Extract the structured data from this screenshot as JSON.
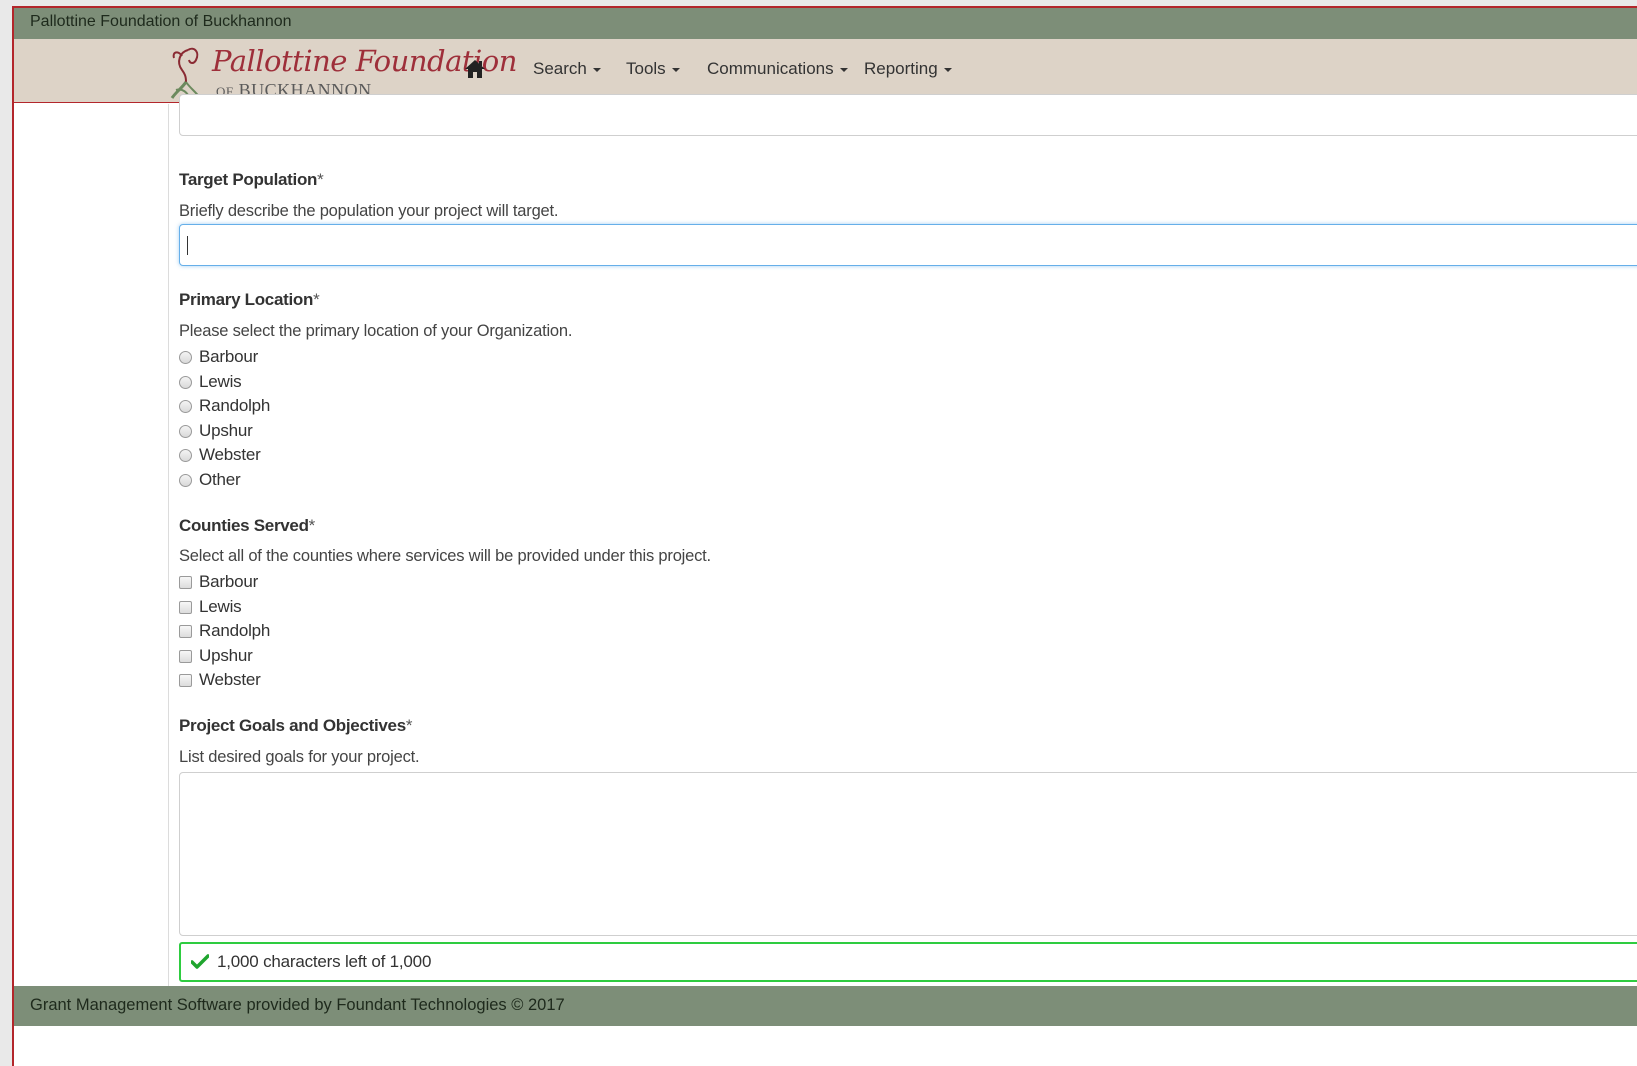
{
  "window": {
    "title": "Pallottine Foundation of Buckhannon"
  },
  "logo": {
    "main": "Pallottine Foundation",
    "sub_of": "OF",
    "sub_name": "BUCKHANNON"
  },
  "nav": {
    "home_icon": "home-icon",
    "items": [
      {
        "label": "Search"
      },
      {
        "label": "Tools"
      },
      {
        "label": "Communications"
      },
      {
        "label": "Reporting"
      }
    ]
  },
  "form": {
    "target_population": {
      "label": "Target Population",
      "required_mark": "*",
      "help": "Briefly describe the population your project will target.",
      "value": ""
    },
    "primary_location": {
      "label": "Primary Location",
      "required_mark": "*",
      "help": "Please select the primary location of your Organization.",
      "options": [
        "Barbour",
        "Lewis",
        "Randolph",
        "Upshur",
        "Webster",
        "Other"
      ]
    },
    "counties_served": {
      "label": "Counties Served",
      "required_mark": "*",
      "help": "Select all of the counties where services will be provided under this project.",
      "options": [
        "Barbour",
        "Lewis",
        "Randolph",
        "Upshur",
        "Webster"
      ]
    },
    "goals": {
      "label": "Project Goals and Objectives",
      "required_mark": "*",
      "help": "List desired goals for your project.",
      "value": "",
      "counter": "1,000 characters left of 1,000",
      "counter_icon": "checkmark-icon"
    }
  },
  "colors": {
    "bar": "#7d8e78",
    "nav": "#ddd3c7",
    "accent": "#b3262b",
    "focus": "#66afe9",
    "success": "#2ecc40"
  },
  "footer": {
    "text": "Grant Management Software provided by Foundant Technologies © 2017"
  }
}
